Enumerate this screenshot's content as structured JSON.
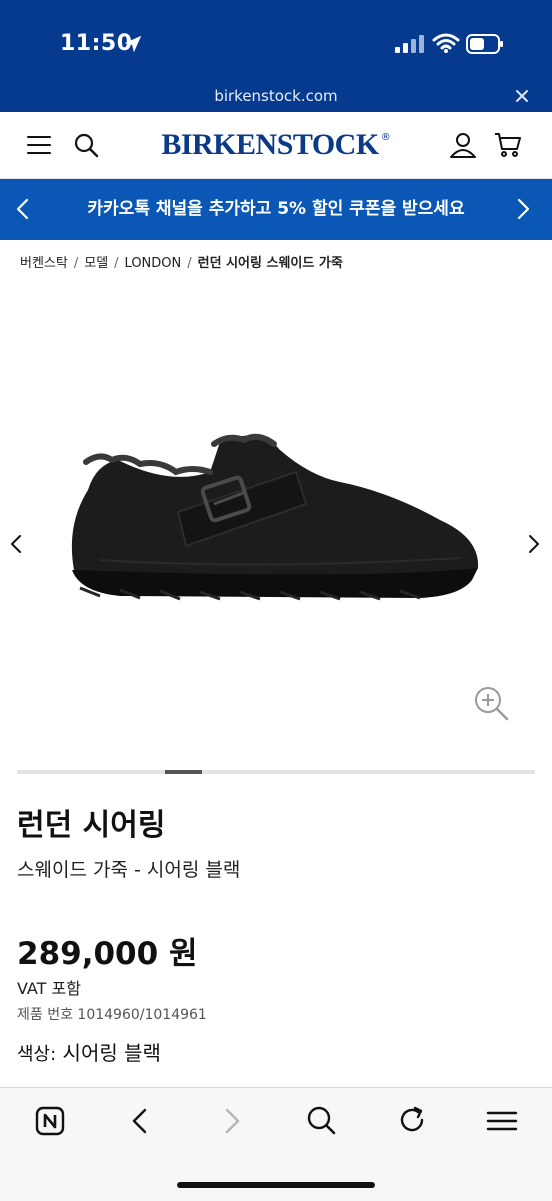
{
  "status_bar": {
    "time": "11:50"
  },
  "browser": {
    "url": "birkenstock.com"
  },
  "header": {
    "logo": "BIRKENSTOCK",
    "logo_mark": "®"
  },
  "promo": {
    "text": "카카오톡 채널을 추가하고 5% 할인 쿠폰을 받으세요"
  },
  "breadcrumb": {
    "items": [
      "버켄스탁",
      "모델",
      "LONDON"
    ],
    "current": "런던 시어링 스웨이드 가죽",
    "separator": "/"
  },
  "gallery": {
    "scroll_position": 0.3
  },
  "product": {
    "name": "런던 시어링",
    "variant": "스웨이드 가죽 - 시어링 블랙",
    "price": "289,000 원",
    "vat": "VAT 포함",
    "product_number": "제품 번호 1014960/1014961",
    "color_label": "색상:",
    "color_value": "시어링 블랙"
  },
  "colors": {
    "brand_blue": "#063a8e",
    "promo_blue": "#0a57b5",
    "logo_blue": "#0b3a86"
  }
}
